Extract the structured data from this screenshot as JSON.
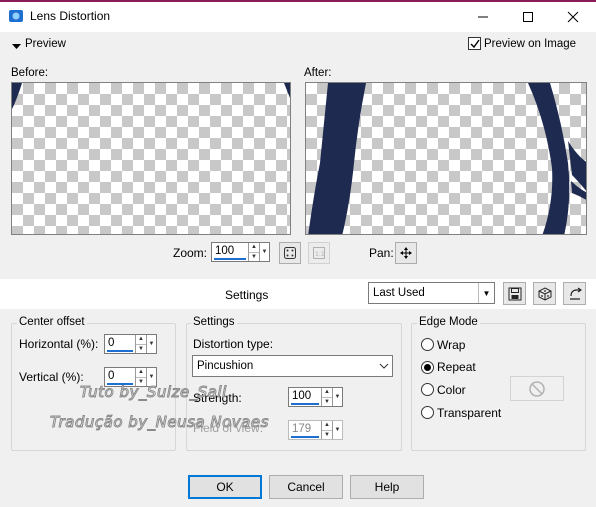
{
  "window": {
    "title": "Lens Distortion",
    "controls": [
      "minimize-icon",
      "maximize-icon",
      "close-icon"
    ]
  },
  "preview": {
    "toggle_label": "Preview",
    "preview_on_image_label": "Preview on Image",
    "preview_on_image_checked": true,
    "before_label": "Before:",
    "after_label": "After:",
    "zoom_label": "Zoom:",
    "zoom_value": "100",
    "pan_label": "Pan:"
  },
  "settings_bar": {
    "label": "Settings",
    "preset_value": "Last Used"
  },
  "center_offset": {
    "title": "Center offset",
    "horizontal_label": "Horizontal (%):",
    "horizontal_value": "0",
    "vertical_label": "Vertical (%):",
    "vertical_value": "0"
  },
  "settings_group": {
    "title": "Settings",
    "distortion_type_label": "Distortion type:",
    "distortion_type_value": "Pincushion",
    "strength_label": "Strength:",
    "strength_value": "100",
    "field_of_view_label": "Field of view:",
    "field_of_view_value": "179"
  },
  "edge_mode": {
    "title": "Edge Mode",
    "options": [
      {
        "label": "Wrap",
        "selected": false
      },
      {
        "label": "Repeat",
        "selected": true
      },
      {
        "label": "Color",
        "selected": false
      },
      {
        "label": "Transparent",
        "selected": false
      }
    ]
  },
  "watermark": {
    "line1": "Tuto by_Suize_Sali",
    "line2": "Tradução by_Neusa Novaes"
  },
  "buttons": {
    "ok": "OK",
    "cancel": "Cancel",
    "help": "Help"
  },
  "colors": {
    "accent": "#0078d7",
    "distortion_shape": "#1e2a50",
    "window_top_border": "#8a1c5a"
  }
}
